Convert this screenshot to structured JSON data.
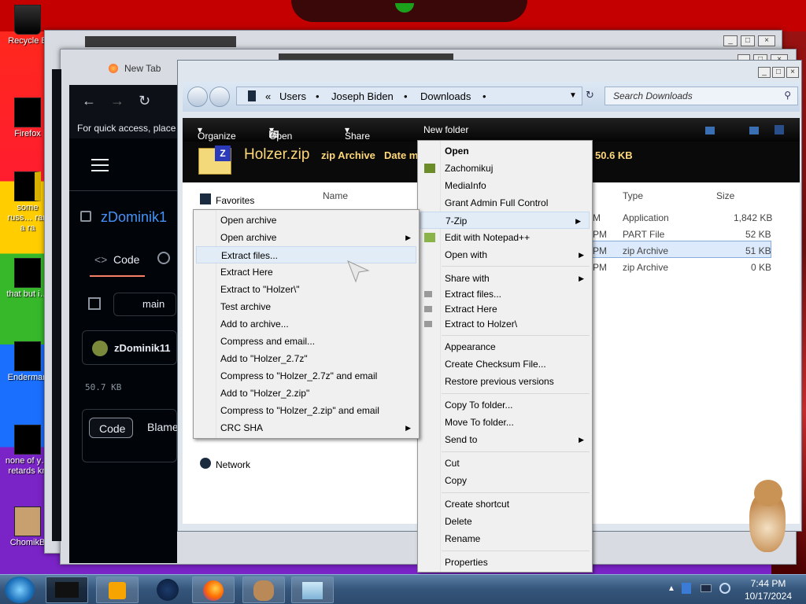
{
  "desktop": {
    "icons": [
      {
        "label": "Recycle B",
        "name": "recycle-bin-icon"
      },
      {
        "label": "Firefox",
        "name": "firefox-icon"
      },
      {
        "label": "some russ… ran a ra",
        "name": "shortcut-icon"
      },
      {
        "label": "that but i…",
        "name": "shortcut-icon"
      },
      {
        "label": "Enderman",
        "name": "enderman-icon"
      },
      {
        "label": "none of y… retards kn",
        "name": "shortcut-icon"
      },
      {
        "label": "ChomikB",
        "name": "hamster-icon"
      }
    ]
  },
  "browser": {
    "tab_title": "New Tab",
    "quick_access": "For quick access, place y",
    "repo_owner": "zDominik1",
    "code_tab": "Code",
    "branch": "main",
    "user": "zDominik11",
    "file_size": "50.7 KB",
    "code_button": "Code",
    "blame_button": "Blame"
  },
  "explorer": {
    "breadcrumb": [
      "Users",
      "Joseph Biden",
      "Downloads"
    ],
    "breadcrumb_prefix": "«",
    "search_placeholder": "Search Downloads",
    "toolbar": {
      "organize": "Organize",
      "open": "Open",
      "share_with": "Share with",
      "new_folder": "New folder"
    },
    "details": {
      "filename": "Holzer.zip",
      "type": "zip Archive",
      "date_label": "Date m",
      "size": "50.6 KB"
    },
    "nav": {
      "favorites": "Favorites",
      "network": "Network"
    },
    "columns": {
      "name": "Name",
      "type": "Type",
      "size": "Size"
    },
    "files": [
      {
        "time": "M",
        "type": "Application",
        "size": "1,842 KB"
      },
      {
        "time": "PM",
        "type": "PART File",
        "size": "52 KB"
      },
      {
        "time": "PM",
        "type": "zip Archive",
        "size": "51 KB"
      },
      {
        "time": "PM",
        "type": "zip Archive",
        "size": "0 KB"
      }
    ]
  },
  "main_menu": {
    "items": [
      {
        "label": "Open",
        "bold": true
      },
      {
        "label": "Zachomikuj"
      },
      {
        "label": "MediaInfo"
      },
      {
        "label": "Grant Admin Full Control"
      },
      {
        "label": "7-Zip"
      },
      {
        "label": "Edit with Notepad++"
      },
      {
        "label": "Open with"
      },
      {
        "label": "Share with"
      },
      {
        "label": "Extract files..."
      },
      {
        "label": "Extract Here"
      },
      {
        "label": "Extract to Holzer\\"
      },
      {
        "label": "Appearance"
      },
      {
        "label": "Create Checksum File..."
      },
      {
        "label": "Restore previous versions"
      },
      {
        "label": "Copy To folder..."
      },
      {
        "label": "Move To folder..."
      },
      {
        "label": "Send to"
      },
      {
        "label": "Cut"
      },
      {
        "label": "Copy"
      },
      {
        "label": "Create shortcut"
      },
      {
        "label": "Delete"
      },
      {
        "label": "Rename"
      },
      {
        "label": "Properties"
      }
    ]
  },
  "zip_menu": {
    "items": [
      {
        "label": "Open archive"
      },
      {
        "label": "Open archive"
      },
      {
        "label": "Extract files..."
      },
      {
        "label": "Extract Here"
      },
      {
        "label": "Extract to \"Holzer\\\""
      },
      {
        "label": "Test archive"
      },
      {
        "label": "Add to archive..."
      },
      {
        "label": "Compress and email..."
      },
      {
        "label": "Add to \"Holzer_2.7z\""
      },
      {
        "label": "Compress to \"Holzer_2.7z\" and email"
      },
      {
        "label": "Add to \"Holzer_2.zip\""
      },
      {
        "label": "Compress to \"Holzer_2.zip\" and email"
      },
      {
        "label": "CRC SHA"
      }
    ]
  },
  "taskbar": {
    "time": "7:44 PM",
    "date": "10/17/2024"
  },
  "colors": {
    "menu_bg": "#f0f0f0",
    "menu_highlight": "#e2ecf7",
    "taskbar": "#35557a",
    "explorer_toolbar": "#111111"
  }
}
